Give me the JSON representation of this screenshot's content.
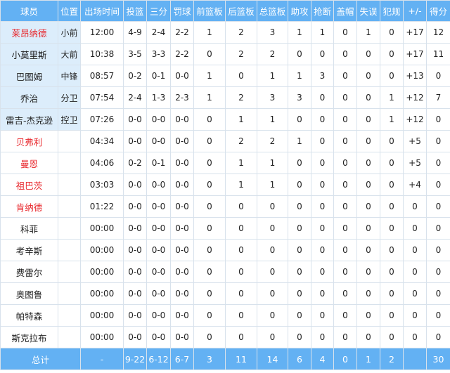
{
  "table": {
    "headers": [
      "球员",
      "位置",
      "出场时间",
      "投篮",
      "三分",
      "罚球",
      "前篮板",
      "后篮板",
      "总篮板",
      "助攻",
      "抢断",
      "盖帽",
      "失误",
      "犯规",
      "+/-",
      "得分"
    ],
    "rows": [
      [
        "莱昂纳德",
        "小前",
        "12:00",
        "4-9",
        "2-4",
        "2-2",
        "1",
        "2",
        "3",
        "1",
        "1",
        "0",
        "1",
        "0",
        "+17",
        "12"
      ],
      [
        "小莫里斯",
        "大前",
        "10:38",
        "3-5",
        "3-3",
        "2-2",
        "0",
        "2",
        "2",
        "0",
        "0",
        "0",
        "0",
        "0",
        "+17",
        "11"
      ],
      [
        "巴图姆",
        "中锋",
        "08:57",
        "0-2",
        "0-1",
        "0-0",
        "1",
        "0",
        "1",
        "1",
        "3",
        "0",
        "0",
        "0",
        "+13",
        "0"
      ],
      [
        "乔治",
        "分卫",
        "07:54",
        "2-4",
        "1-3",
        "2-3",
        "1",
        "2",
        "3",
        "3",
        "0",
        "0",
        "0",
        "1",
        "+12",
        "7"
      ],
      [
        "雷吉-杰克逊",
        "控卫",
        "07:26",
        "0-0",
        "0-0",
        "0-0",
        "0",
        "1",
        "1",
        "0",
        "0",
        "0",
        "0",
        "1",
        "+12",
        "0"
      ],
      [
        "贝弗利",
        "",
        "04:34",
        "0-0",
        "0-0",
        "0-0",
        "0",
        "2",
        "2",
        "1",
        "0",
        "0",
        "0",
        "0",
        "+5",
        "0"
      ],
      [
        "曼恩",
        "",
        "04:06",
        "0-2",
        "0-1",
        "0-0",
        "0",
        "1",
        "1",
        "0",
        "0",
        "0",
        "0",
        "0",
        "+5",
        "0"
      ],
      [
        "祖巴茨",
        "",
        "03:03",
        "0-0",
        "0-0",
        "0-0",
        "0",
        "1",
        "1",
        "0",
        "0",
        "0",
        "0",
        "0",
        "+4",
        "0"
      ],
      [
        "肯纳德",
        "",
        "01:22",
        "0-0",
        "0-0",
        "0-0",
        "0",
        "0",
        "0",
        "0",
        "0",
        "0",
        "0",
        "0",
        "0",
        "0"
      ],
      [
        "科菲",
        "",
        "00:00",
        "0-0",
        "0-0",
        "0-0",
        "0",
        "0",
        "0",
        "0",
        "0",
        "0",
        "0",
        "0",
        "0",
        "0"
      ],
      [
        "考辛斯",
        "",
        "00:00",
        "0-0",
        "0-0",
        "0-0",
        "0",
        "0",
        "0",
        "0",
        "0",
        "0",
        "0",
        "0",
        "0",
        "0"
      ],
      [
        "费雷尔",
        "",
        "00:00",
        "0-0",
        "0-0",
        "0-0",
        "0",
        "0",
        "0",
        "0",
        "0",
        "0",
        "0",
        "0",
        "0",
        "0"
      ],
      [
        "奥图鲁",
        "",
        "00:00",
        "0-0",
        "0-0",
        "0-0",
        "0",
        "0",
        "0",
        "0",
        "0",
        "0",
        "0",
        "0",
        "0",
        "0"
      ],
      [
        "帕特森",
        "",
        "00:00",
        "0-0",
        "0-0",
        "0-0",
        "0",
        "0",
        "0",
        "0",
        "0",
        "0",
        "0",
        "0",
        "0",
        "0"
      ],
      [
        "斯克拉布",
        "",
        "00:00",
        "0-0",
        "0-0",
        "0-0",
        "0",
        "0",
        "0",
        "0",
        "0",
        "0",
        "0",
        "0",
        "0",
        "0"
      ]
    ],
    "totals": [
      "总计",
      "-",
      "9-22",
      "6-12",
      "6-7",
      "3",
      "11",
      "14",
      "6",
      "4",
      "0",
      "1",
      "2",
      "",
      "30"
    ]
  },
  "colors": {
    "header_bg": "#63b1f3",
    "header_text": "#ffffff",
    "starter_bg": "#dcedfb",
    "highlight_name": "#e8262b",
    "grid_line": "#d8e2ec"
  }
}
